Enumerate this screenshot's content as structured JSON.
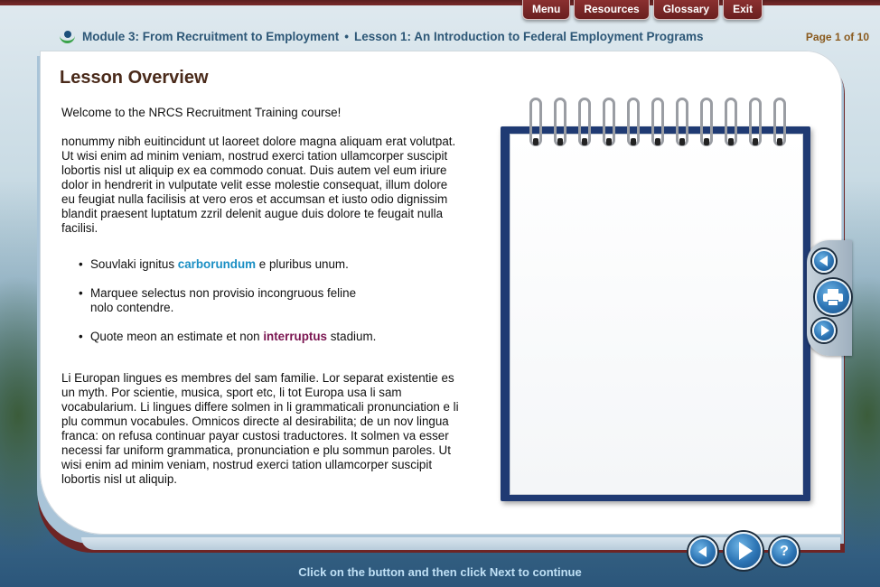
{
  "menu": {
    "items": [
      {
        "label": "Menu"
      },
      {
        "label": "Resources"
      },
      {
        "label": "Glossary"
      },
      {
        "label": "Exit"
      }
    ]
  },
  "breadcrumb": {
    "module": "Module 3: From Recruitment to Employment",
    "separator": "•",
    "lesson": "Lesson 1: An Introduction to Federal Employment Programs"
  },
  "page_indicator": {
    "prefix": "Page",
    "current": "1",
    "of": "of",
    "total": "10"
  },
  "lesson": {
    "title": "Lesson Overview",
    "welcome": "Welcome to the NRCS Recruitment Training course!",
    "paragraph1": "nonummy nibh euitincidunt ut laoreet dolore magna aliquam erat volutpat. Ut wisi enim ad minim veniam, nostrud exerci tation ullamcorper suscipit lobortis nisl ut aliquip ex ea commodo conuat. Duis autem vel eum iriure dolor in hendrerit in vulputate velit esse molestie consequat, illum dolore eu feugiat nulla facilisis at vero eros et accumsan et iusto odio dignissim blandit praesent luptatum zzril delenit augue duis dolore te feugait nulla facilisi.",
    "bullets": [
      {
        "before": "Souvlaki ignitus ",
        "link": "carborundum",
        "after": " e pluribus unum."
      },
      {
        "before": "Marquee selectus non provisio incongruous feline nolo contendre.",
        "link": "",
        "after": ""
      },
      {
        "before": "Quote meon an estimate et non ",
        "link": "interruptus",
        "after": " stadium."
      }
    ],
    "paragraph2": "Li Europan lingues es membres del sam familie. Lor separat existentie es un myth. Por scientie, musica, sport etc, li tot Europa usa li sam vocabularium. Li lingues differe solmen in li grammaticali pronunciation e li plu commun vocabules. Omnicos directe al desirabilita; de un nov lingua franca: on refusa continuar payar custosi traductores. It solmen va esser necessi far uniform grammatica, pronunciation e plu sommun paroles. Ut wisi enim ad minim veniam, nostrud exerci tation ullamcorper suscipit lobortis nisl ut aliquip."
  },
  "colors": {
    "link_blue": "#1a8fc4",
    "link_purple": "#7a1450",
    "brand_maroon": "#6e2424",
    "nav_blue": "#2c74b4"
  },
  "icons": {
    "side_prev": "chevron-left-icon",
    "side_print": "print-icon",
    "side_next": "chevron-right-icon",
    "bottom_back": "back-arrow-icon",
    "bottom_next": "next-arrow-icon",
    "bottom_help": "help-icon"
  },
  "help_glyph": "?",
  "instruction": "Click on the button and then click Next to continue"
}
